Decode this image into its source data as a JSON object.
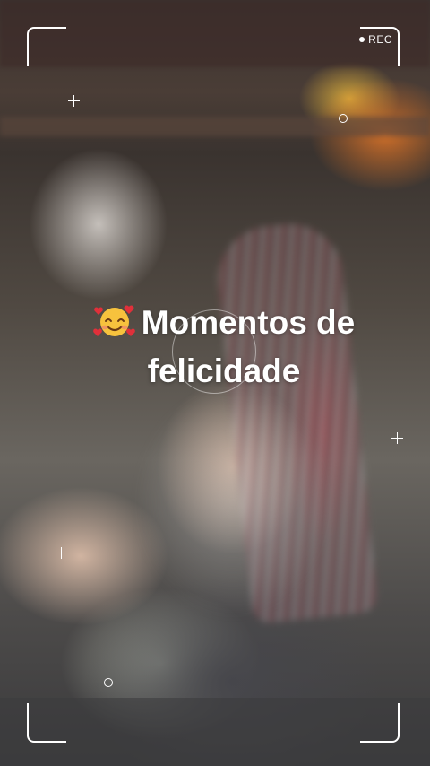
{
  "overlay": {
    "rec_label": "REC"
  },
  "caption": {
    "emoji_name": "smiling-face-with-hearts",
    "line1": "Momentos de",
    "line2": "felicidade"
  },
  "colors": {
    "overlay_white": "#ffffff"
  }
}
